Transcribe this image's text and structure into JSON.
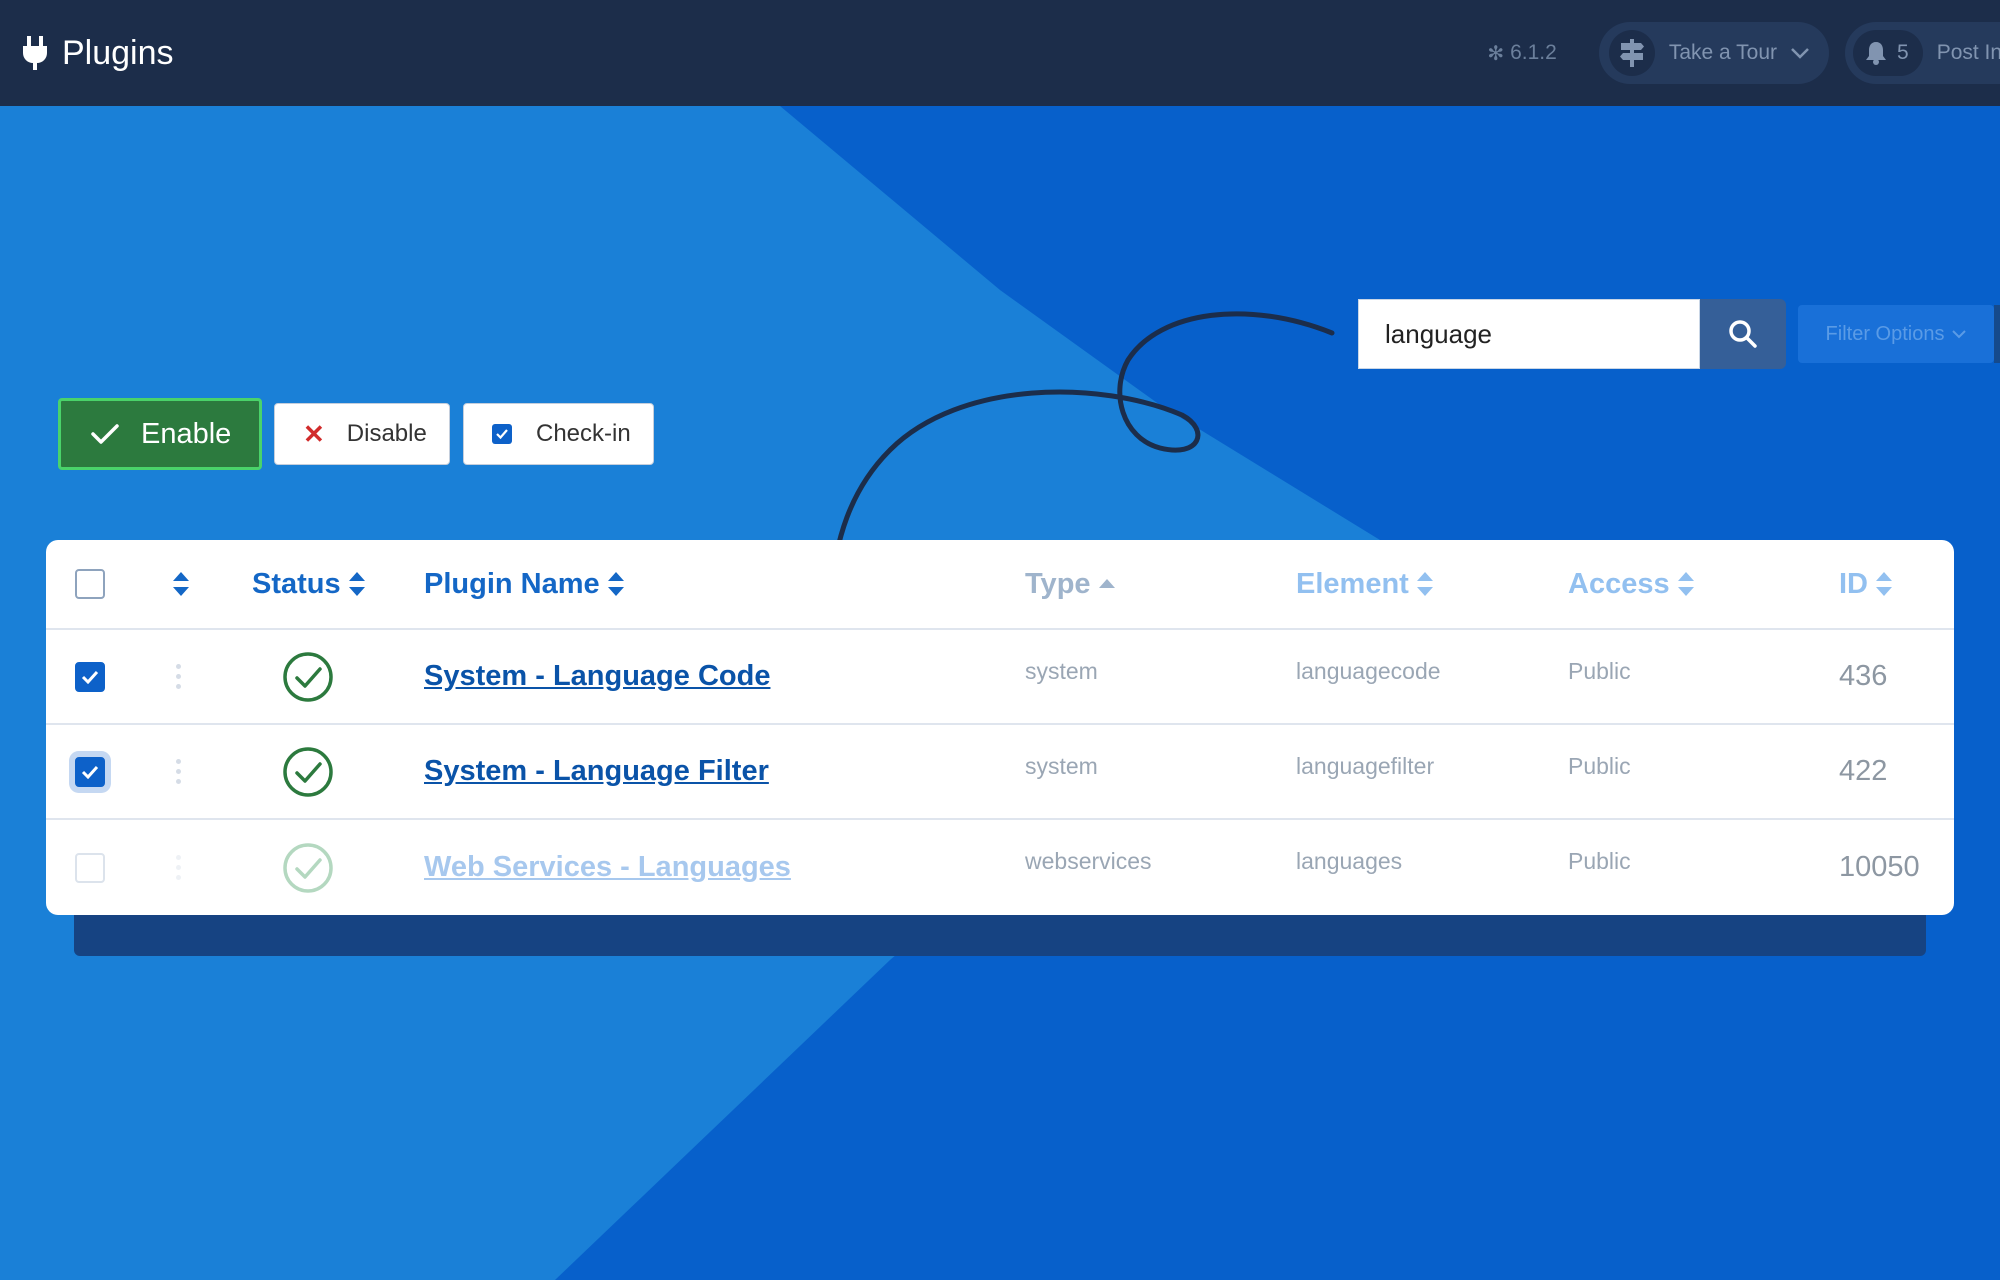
{
  "header": {
    "title": "Plugins",
    "version": "6.1.2",
    "tour_label": "Take a Tour",
    "notification_count": "5",
    "post_label": "Post Installation Messages"
  },
  "search": {
    "value": "language",
    "filter_label": "Filter Options"
  },
  "toolbar": {
    "enable_label": "Enable",
    "disable_label": "Disable",
    "checkin_label": "Check-in"
  },
  "table": {
    "headers": {
      "status": "Status",
      "name": "Plugin Name",
      "type": "Type",
      "element": "Element",
      "access": "Access",
      "id": "ID"
    },
    "rows": [
      {
        "checked": true,
        "name": "System - Language Code",
        "type": "system",
        "element": "languagecode",
        "access": "Public",
        "id": "436"
      },
      {
        "checked": true,
        "name": "System - Language Filter",
        "type": "system",
        "element": "languagefilter",
        "access": "Public",
        "id": "422"
      },
      {
        "checked": false,
        "name": "Web Services - Languages",
        "type": "webservices",
        "element": "languages",
        "access": "Public",
        "id": "10050"
      }
    ]
  },
  "colors": {
    "header_bg": "#1c2d4a",
    "page_bg": "#0760cb",
    "enable_green": "#2c7a3e",
    "link_blue": "#0a53a8"
  },
  "icons": [
    "plug-icon",
    "joomla-icon",
    "signpost-icon",
    "bell-icon",
    "search-icon",
    "check-icon",
    "close-icon",
    "sort-icon",
    "status-check-icon"
  ]
}
